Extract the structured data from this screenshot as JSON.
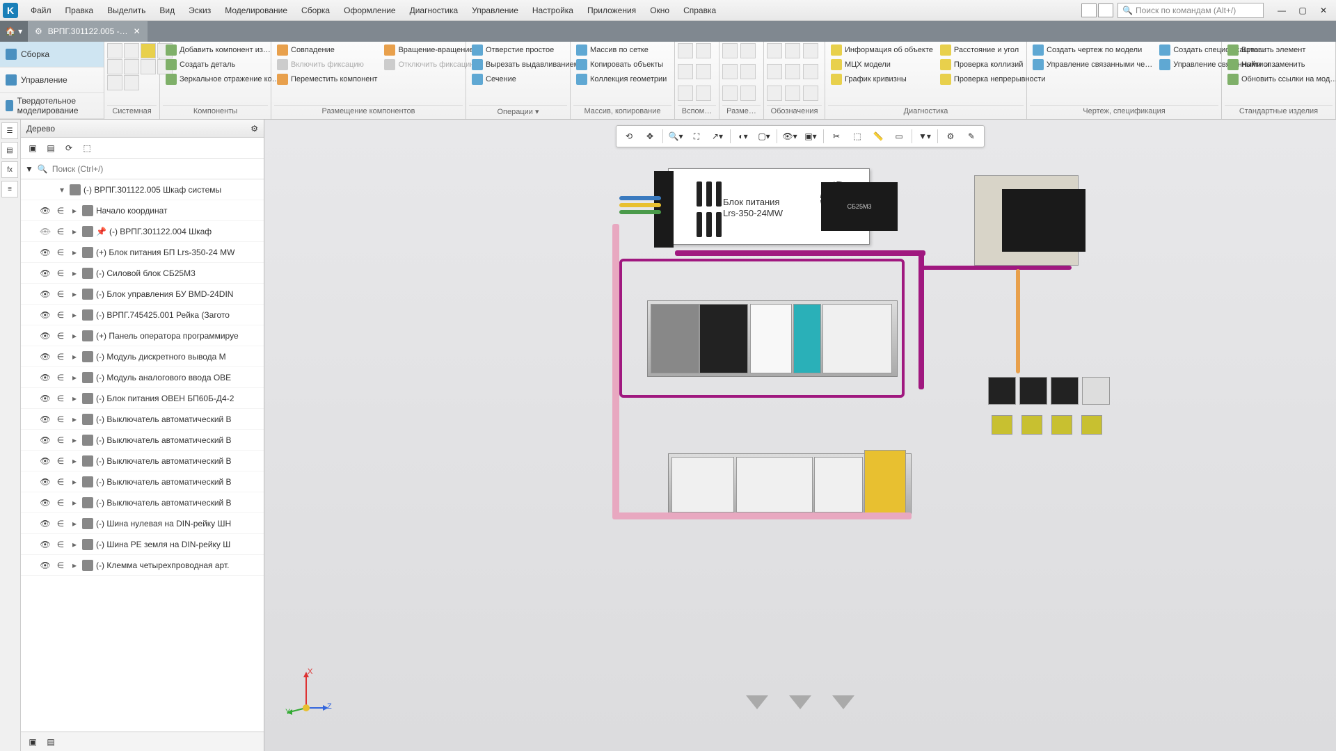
{
  "menu": {
    "items": [
      "Файл",
      "Правка",
      "Выделить",
      "Вид",
      "Эскиз",
      "Моделирование",
      "Сборка",
      "Оформление",
      "Диагностика",
      "Управление",
      "Настройка",
      "Приложения",
      "Окно",
      "Справка"
    ],
    "search_placeholder": "Поиск по командам (Alt+/)"
  },
  "tabs": {
    "doc_title": "ВРПГ.301122.005 -…"
  },
  "ribbon_left": {
    "items": [
      "Сборка",
      "Управление",
      "Твердотельное моделирование"
    ],
    "active_index": 0
  },
  "ribbon_groups": {
    "system": {
      "label": "Системная"
    },
    "components": {
      "label": "Компоненты",
      "btns": [
        "Добавить компонент из…",
        "Создать деталь",
        "Зеркальное отражение ко…",
        "Совпадение",
        "Включить фиксацию",
        "Отключить фиксацию",
        "Переместить компонент"
      ]
    },
    "placement": {
      "label": "Размещение компонентов",
      "btns": [
        "Вращение-вращение"
      ]
    },
    "operations": {
      "label": "Операции",
      "btns": [
        "Отверстие простое",
        "Вырезать выдавливанием",
        "Сечение"
      ]
    },
    "array": {
      "label": "Массив, копирование",
      "btns": [
        "Массив по сетке",
        "Копировать объекты",
        "Коллекция геометрии"
      ]
    },
    "aux": {
      "label": "Вспом…"
    },
    "dims": {
      "label": "Разме…"
    },
    "annot": {
      "label": "Обозначения"
    },
    "diag": {
      "label": "Диагностика",
      "btns": [
        "Информация об объекте",
        "МЦХ модели",
        "График кривизны",
        "Расстояние и угол",
        "Проверка коллизий",
        "Проверка непрерывности"
      ]
    },
    "draw": {
      "label": "Чертеж, спецификация",
      "btns": [
        "Создать чертеж по модели",
        "Управление связанными че…",
        "Создать спецификацию…",
        "Управление связанными сп…"
      ]
    },
    "std": {
      "label": "Стандартные изделия",
      "btns": [
        "Вставить элемент",
        "Найти и заменить",
        "Обновить ссылки на мод…"
      ]
    }
  },
  "tree": {
    "title": "Дерево",
    "search_placeholder": "Поиск (Ctrl+/)",
    "root": "(-) ВРПГ.301122.005 Шкаф системы",
    "nodes": [
      {
        "vis": "●",
        "label": "Начало координат",
        "indent": 1,
        "exp": "▸"
      },
      {
        "vis": "⤫",
        "label": "(-) ВРПГ.301122.004 Шкаф",
        "indent": 1,
        "exp": "▸",
        "pin": true
      },
      {
        "vis": "●",
        "label": "(+) Блок питания БП Lrs-350-24 MW",
        "indent": 1,
        "exp": "▸"
      },
      {
        "vis": "●",
        "label": "(-) Силовой блок СБ25М3",
        "indent": 1,
        "exp": "▸"
      },
      {
        "vis": "●",
        "label": "(-) Блок управления БУ BMD-24DIN",
        "indent": 1,
        "exp": "▸"
      },
      {
        "vis": "●",
        "label": "(-) ВРПГ.745425.001  Рейка  (Загото",
        "indent": 1,
        "exp": "▸"
      },
      {
        "vis": "●",
        "label": "(+) Панель оператора программируе",
        "indent": 1,
        "exp": "▸"
      },
      {
        "vis": "●",
        "label": "(-) Модуль дискретного вывода  М",
        "indent": 1,
        "exp": "▸"
      },
      {
        "vis": "●",
        "label": "(-) Модуль аналогового ввода ОВЕ",
        "indent": 1,
        "exp": "▸"
      },
      {
        "vis": "●",
        "label": "(-) Блок питания ОВЕН БП60Б-Д4-2",
        "indent": 1,
        "exp": "▸"
      },
      {
        "vis": "●",
        "label": "(-) Выключатель автоматический  В",
        "indent": 1,
        "exp": "▸"
      },
      {
        "vis": "●",
        "label": "(-) Выключатель автоматический В",
        "indent": 1,
        "exp": "▸"
      },
      {
        "vis": "●",
        "label": "(-) Выключатель автоматический  В",
        "indent": 1,
        "exp": "▸"
      },
      {
        "vis": "●",
        "label": "(-) Выключатель автоматический В",
        "indent": 1,
        "exp": "▸"
      },
      {
        "vis": "●",
        "label": "(-) Выключатель автоматический В",
        "indent": 1,
        "exp": "▸"
      },
      {
        "vis": "●",
        "label": "(-) Шина нулевая на DIN-рейку ШН",
        "indent": 1,
        "exp": "▸"
      },
      {
        "vis": "●",
        "label": "(-) Шина PE земля на DIN-рейку  Ш",
        "indent": 1,
        "exp": "▸"
      },
      {
        "vis": "●",
        "label": "(-) Клемма четырехпроводная арт.",
        "indent": 1,
        "exp": "▸"
      }
    ]
  },
  "model": {
    "psu_line1": "Блок питания",
    "psu_line2": "Lrs-350-24MW",
    "sb_label": "СБ25М3"
  },
  "axis": {
    "x": "X",
    "y": "Y",
    "z": "Z"
  }
}
